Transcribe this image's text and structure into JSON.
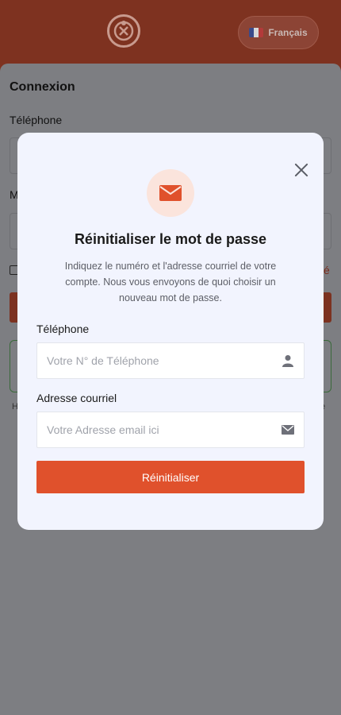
{
  "header": {
    "language_label": "Français",
    "colors": {
      "header_bg": "#7e3220",
      "accent": "#e0512c"
    }
  },
  "login": {
    "title": "Connexion",
    "phone_label": "Téléphone",
    "password_label_fragment": "M",
    "forgot_fragment": "é",
    "footer_left_fragment": "H",
    "footer_right_fragment": "e"
  },
  "modal": {
    "icon": "mail-icon",
    "title": "Réinitialiser le mot de passe",
    "description": "Indiquez le numéro et l'adresse courriel de votre compte. Nous vous envoyons de quoi choisir un nouveau mot de passe.",
    "phone": {
      "label": "Téléphone",
      "placeholder": "Votre N° de Téléphone",
      "value": "",
      "icon": "user-icon"
    },
    "email": {
      "label": "Adresse courriel",
      "placeholder": "Votre Adresse email ici",
      "value": "",
      "icon": "envelope-icon"
    },
    "submit_label": "Réinitialiser",
    "close_icon": "close-icon"
  }
}
